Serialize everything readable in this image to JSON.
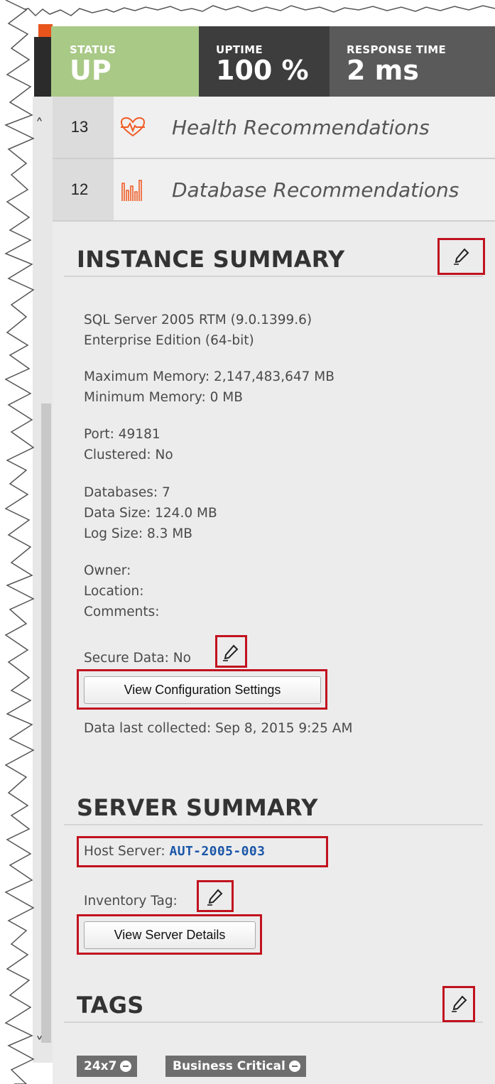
{
  "header": {
    "status_label": "STATUS",
    "status_value": "UP",
    "uptime_label": "UPTIME",
    "uptime_value": "100 %",
    "response_label": "RESPONSE TIME",
    "response_value": "2 ms"
  },
  "recommendations": [
    {
      "count": "13",
      "icon": "heart-pulse-icon",
      "label": "Health Recommendations"
    },
    {
      "count": "12",
      "icon": "bar-chart-icon",
      "label": "Database Recommendations"
    }
  ],
  "instance_summary": {
    "title": "INSTANCE SUMMARY",
    "version_line1": "SQL Server 2005 RTM (9.0.1399.6)",
    "version_line2": "Enterprise Edition (64-bit)",
    "max_memory": "Maximum Memory: 2,147,483,647 MB",
    "min_memory": "Minimum Memory: 0 MB",
    "port": "Port: 49181",
    "clustered": "Clustered: No",
    "databases": "Databases: 7",
    "data_size": "Data Size: 124.0 MB",
    "log_size": "Log Size: 8.3 MB",
    "owner": "Owner:",
    "location": "Location:",
    "comments": "Comments:",
    "secure_data": "Secure Data: No",
    "view_config_button": "View Configuration Settings",
    "last_collected": "Data last collected: Sep 8, 2015 9:25 AM"
  },
  "server_summary": {
    "title": "SERVER SUMMARY",
    "host_label": "Host Server: ",
    "host_value": "AUT-2005-003",
    "inventory_tag": "Inventory Tag:",
    "view_server_button": "View Server Details"
  },
  "tags": {
    "title": "TAGS",
    "items": [
      "24x7",
      "Business Critical"
    ]
  },
  "colors": {
    "status_green": "#a9c986",
    "accent_orange": "#e8541c",
    "highlight_red": "#c1121f",
    "link_blue": "#1a56a8"
  }
}
